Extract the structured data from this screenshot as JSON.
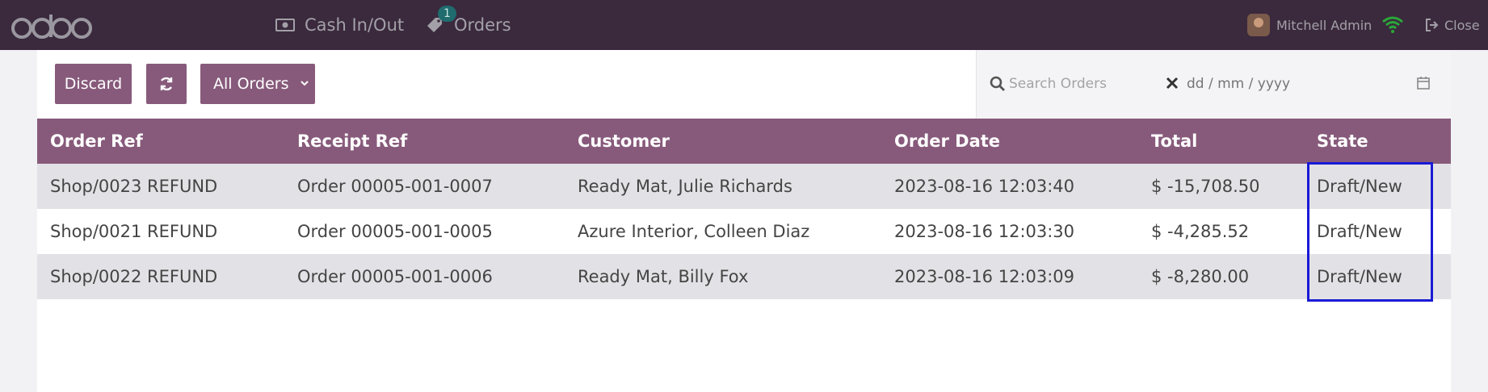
{
  "header": {
    "logo_text": "odoo",
    "nav": [
      {
        "label": "Cash In/Out",
        "icon": "cash-icon"
      },
      {
        "label": "Orders",
        "icon": "tag-icon",
        "badge": "1"
      }
    ],
    "user_name": "Mitchell Admin",
    "close_label": "Close",
    "colors": {
      "bar": "#3b2a3d",
      "text": "#a3a0a8",
      "wifi": "#2aa83a"
    }
  },
  "toolbar": {
    "discard_label": "Discard",
    "refresh_icon": "refresh-icon",
    "filter_label": "All Orders",
    "search_placeholder": "Search Orders",
    "date_placeholder": "dd / mm / yyyy",
    "accent": "#875a7b"
  },
  "table": {
    "columns": [
      "Order Ref",
      "Receipt Ref",
      "Customer",
      "Order Date",
      "Total",
      "State"
    ],
    "rows": [
      {
        "order_ref": "Shop/0023 REFUND",
        "receipt_ref": "Order 00005-001-0007",
        "customer": "Ready Mat, Julie Richards",
        "date": "2023-08-16 12:03:40",
        "total": "$ -15,708.50",
        "state": "Draft/New"
      },
      {
        "order_ref": "Shop/0021 REFUND",
        "receipt_ref": "Order 00005-001-0005",
        "customer": "Azure Interior, Colleen Diaz",
        "date": "2023-08-16 12:03:30",
        "total": "$ -4,285.52",
        "state": "Draft/New"
      },
      {
        "order_ref": "Shop/0022 REFUND",
        "receipt_ref": "Order 00005-001-0006",
        "customer": "Ready Mat, Billy Fox",
        "date": "2023-08-16 12:03:09",
        "total": "$ -8,280.00",
        "state": "Draft/New"
      }
    ]
  },
  "highlight_color": "#1a1ad6"
}
